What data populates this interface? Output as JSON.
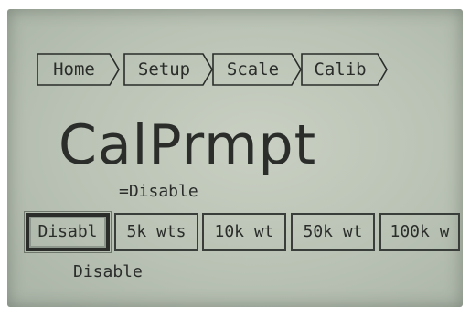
{
  "breadcrumb": {
    "items": [
      {
        "label": "Home"
      },
      {
        "label": "Setup"
      },
      {
        "label": "Scale"
      },
      {
        "label": "Calib"
      }
    ]
  },
  "screen": {
    "title": "CalPrmpt",
    "current_value": "=Disable"
  },
  "options": {
    "items": [
      {
        "label": "Disabl",
        "selected": true
      },
      {
        "label": "5k wts",
        "selected": false
      },
      {
        "label": "10k wt",
        "selected": false
      },
      {
        "label": "50k wt",
        "selected": false
      },
      {
        "label": "100k w",
        "selected": false
      }
    ],
    "selected_full_label": "Disable"
  },
  "colors": {
    "lcd_background": "#bfc7bb",
    "lcd_text": "#2a2d2a"
  }
}
